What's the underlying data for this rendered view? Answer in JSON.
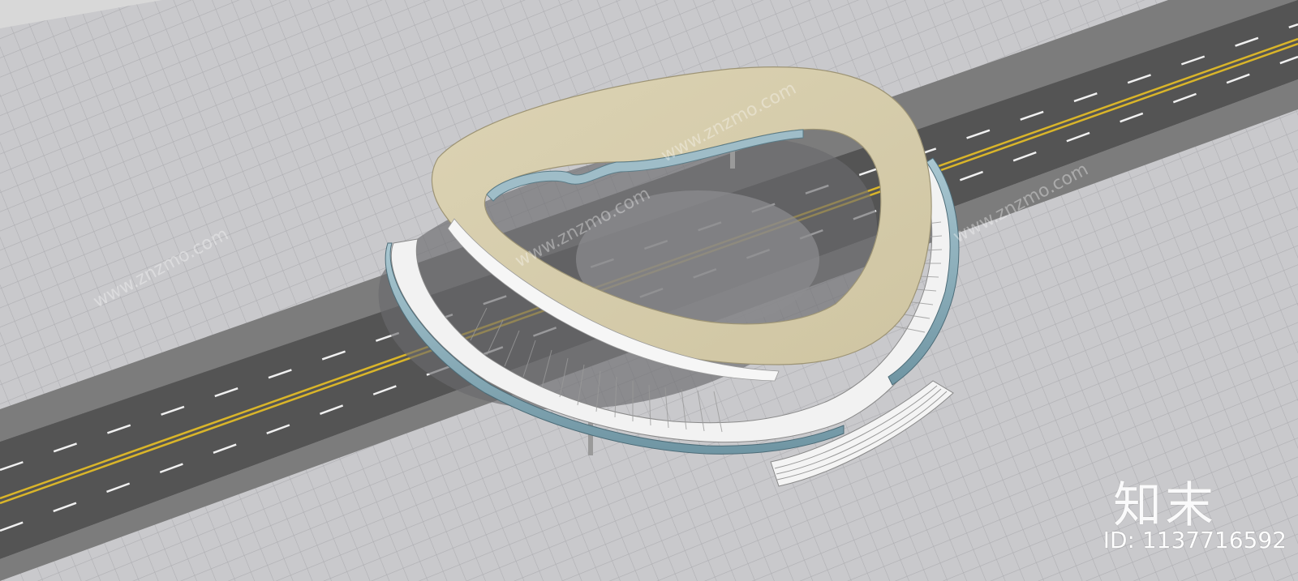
{
  "watermark": {
    "logo_text": "知末",
    "id_text": "ID: 1137716592",
    "site_text": "www.znzmo.com"
  },
  "colors": {
    "plaza": "#c9c9cc",
    "plaza_grid": "#b0b0b4",
    "road": "#545454",
    "road_edge": "#8a8a8a",
    "center_line": "#d9b52a",
    "lane_dash": "#f2f2f2",
    "bridge_deck": "#d6cdab",
    "stair": "#f2f2f2",
    "glass": "#8fb3c0",
    "shadow": "#6d6d70"
  },
  "icons": [
    "znzmo-logo-icon"
  ]
}
